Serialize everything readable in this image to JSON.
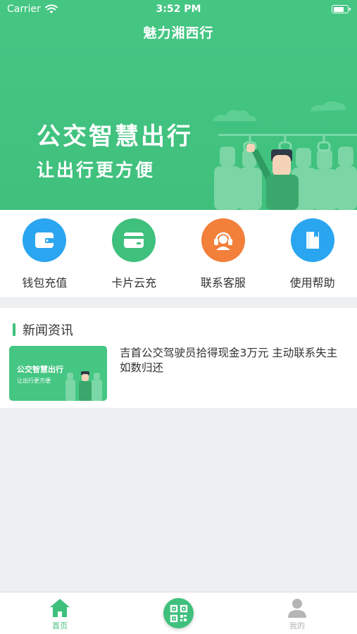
{
  "status_bar": {
    "carrier": "Carrier",
    "time": "3:52 PM",
    "battery_level": 0.8
  },
  "nav": {
    "title": "魅力湘西行"
  },
  "banner": {
    "line1": "公交智慧出行",
    "line2": "让出行更方便"
  },
  "quick_actions": [
    {
      "label": "钱包充值",
      "icon": "wallet-icon",
      "color": "#2aa5f0"
    },
    {
      "label": "卡片云充",
      "icon": "card-icon",
      "color": "#3fc07d"
    },
    {
      "label": "联系客服",
      "icon": "headset-icon",
      "color": "#f27f3a"
    },
    {
      "label": "使用帮助",
      "icon": "book-icon",
      "color": "#2aa5f0"
    }
  ],
  "news": {
    "section_title": "新闻资讯",
    "items": [
      {
        "thumb_line1": "公交智慧出行",
        "thumb_line2": "让出行更方便",
        "headline": "吉首公交驾驶员拾得现金3万元 主动联系失主如数归还"
      }
    ]
  },
  "tabbar": {
    "home_label": "首页",
    "mine_label": "我的",
    "active_color": "#3fc07d",
    "inactive_color": "#b5b5b5"
  }
}
